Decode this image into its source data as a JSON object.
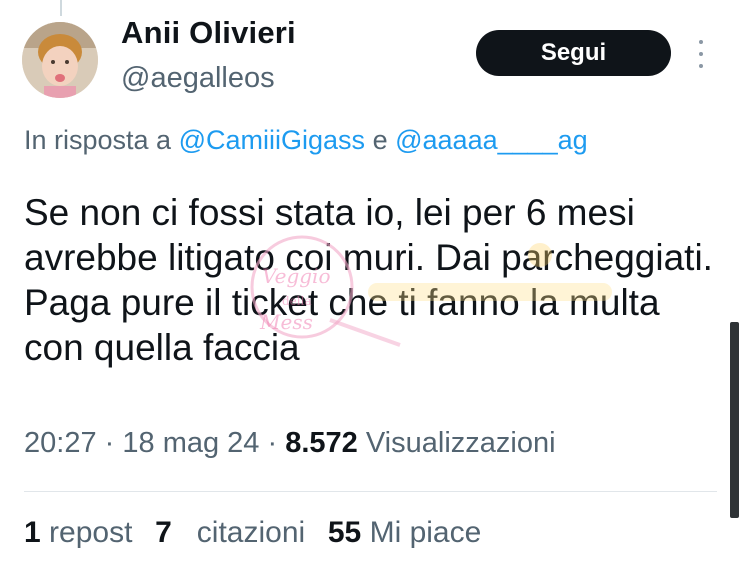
{
  "author": {
    "name": "Anii Olivieri",
    "handle": "@aegalleos"
  },
  "actions": {
    "follow_label": "Segui",
    "more_icon": "more-vertical-icon"
  },
  "reply": {
    "prefix": "In risposta a",
    "mention1": "@CamiiiGigass",
    "conjunction": "e",
    "mention2": "@aaaaa____ag"
  },
  "tweet": {
    "text": "Se non ci fossi stata io, lei per 6 mesi avrebbe litigato coi muri. Dai parcheggiati. Paga pure il ticket che ti fanno la multa con quella faccia"
  },
  "meta": {
    "time": "20:27",
    "date": "18 mag 24",
    "views_count": "8.572",
    "views_label": "Visualizzazioni"
  },
  "stats": {
    "reposts_count": "1",
    "reposts_label": "repost",
    "quotes_count": "7",
    "quotes_label": "citazioni",
    "likes_count": "55",
    "likes_label": "Mi piace"
  },
  "colors": {
    "text": "#0f1419",
    "secondary": "#536471",
    "link": "#1d9bf0",
    "button_bg": "#0f1419"
  }
}
